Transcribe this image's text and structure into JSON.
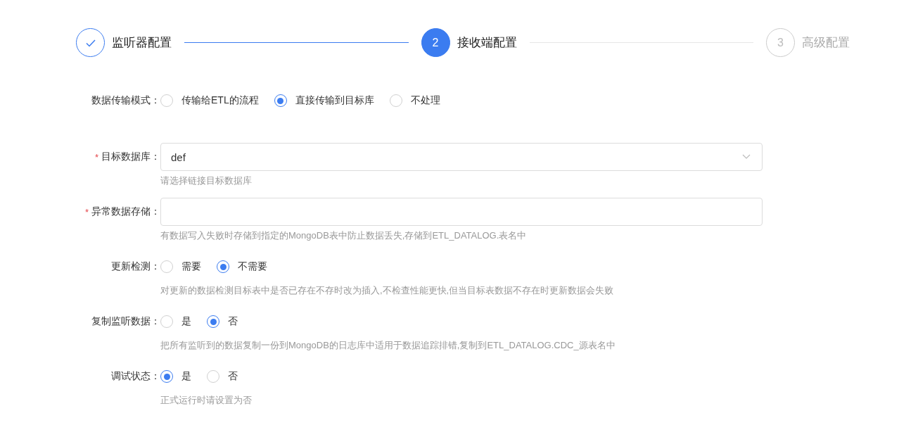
{
  "steps": [
    {
      "kind": "finished",
      "title": "监听器配置"
    },
    {
      "kind": "current",
      "number": "2",
      "title": "接收端配置"
    },
    {
      "kind": "pending",
      "number": "3",
      "title": "高级配置"
    }
  ],
  "form": [
    {
      "kind": "radio",
      "label": "数据传输模式：",
      "options": [
        {
          "label": "传输给ETL的流程",
          "selected": false
        },
        {
          "label": "直接传输到目标库",
          "selected": true
        },
        {
          "label": "不处理",
          "selected": false
        }
      ]
    },
    {
      "kind": "select",
      "label": "目标数据库：",
      "required_mark": "*",
      "value": "def",
      "help": "请选择链接目标数据库"
    },
    {
      "kind": "input",
      "label": "异常数据存储：",
      "required_mark": "*",
      "help": "有数据写入失败时存储到指定的MongoDB表中防止数据丢失,存储到ETL_DATALOG.表名中"
    },
    {
      "kind": "radio",
      "label": "更新检测：",
      "options": [
        {
          "label": "需要",
          "selected": false
        },
        {
          "label": "不需要",
          "selected": true
        }
      ],
      "help": "对更新的数据检测目标表中是否已存在不存时改为插入,不检查性能更快,但当目标表数据不存在时更新数据会失败"
    },
    {
      "kind": "radio",
      "label": "复制监听数据：",
      "options": [
        {
          "label": "是",
          "selected": false
        },
        {
          "label": "否",
          "selected": true
        }
      ],
      "help": "把所有监听到的数据复制一份到MongoDB的日志库中适用于数据追踪排错,复制到ETL_DATALOG.CDC_源表名中"
    },
    {
      "kind": "radio",
      "label": "调试状态：",
      "options": [
        {
          "label": "是",
          "selected": true
        },
        {
          "label": "否",
          "selected": false
        }
      ],
      "help": "正式运行时请设置为否"
    }
  ]
}
